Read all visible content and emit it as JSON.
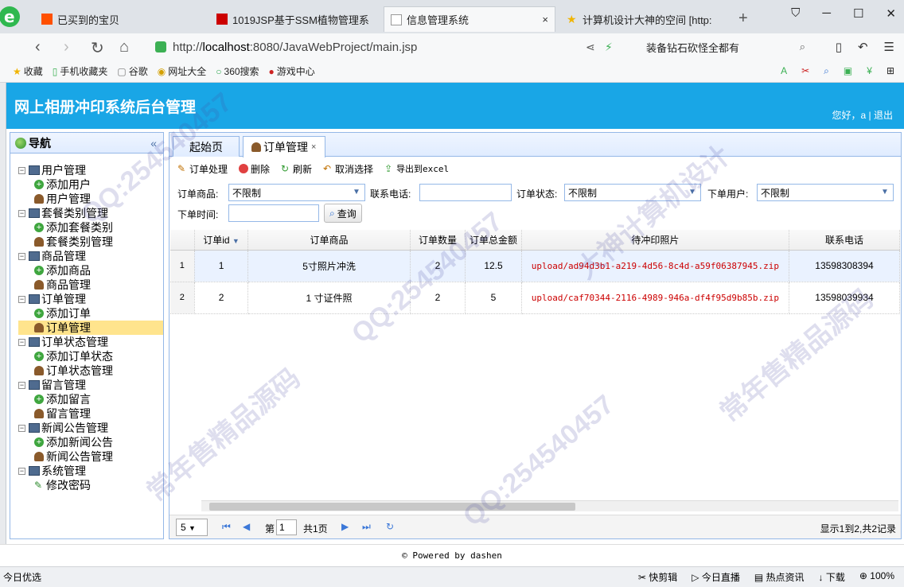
{
  "browser": {
    "tabs": [
      {
        "label": "已买到的宝贝"
      },
      {
        "label": "1019JSP基于SSM植物管理系"
      },
      {
        "label": "信息管理系统",
        "close": "×"
      },
      {
        "label": "计算机设计大神的空间 [http:"
      }
    ],
    "new_tab": "+",
    "url_prefix": "http://",
    "url_host": "localhost",
    "url_rest": ":8080/JavaWebProject/main.jsp",
    "search_text": "装备钻石砍怪全都有",
    "bookmarks": [
      "收藏",
      "手机收藏夹",
      "谷歌",
      "网址大全",
      "360搜索",
      "游戏中心"
    ]
  },
  "app": {
    "title": "网上相册冲印系统后台管理",
    "greeting": "您好，a",
    "logout": "退出"
  },
  "nav": {
    "title": "导航",
    "collapse": "«",
    "groups": [
      {
        "label": "用户管理",
        "children": [
          {
            "label": "添加用户",
            "icon": "add"
          },
          {
            "label": "用户管理",
            "icon": "person"
          }
        ]
      },
      {
        "label": "套餐类别管理",
        "children": [
          {
            "label": "添加套餐类别",
            "icon": "add"
          },
          {
            "label": "套餐类别管理",
            "icon": "person"
          }
        ]
      },
      {
        "label": "商品管理",
        "children": [
          {
            "label": "添加商品",
            "icon": "add"
          },
          {
            "label": "商品管理",
            "icon": "person"
          }
        ]
      },
      {
        "label": "订单管理",
        "children": [
          {
            "label": "添加订单",
            "icon": "add"
          },
          {
            "label": "订单管理",
            "icon": "person",
            "selected": true
          }
        ]
      },
      {
        "label": "订单状态管理",
        "children": [
          {
            "label": "添加订单状态",
            "icon": "add"
          },
          {
            "label": "订单状态管理",
            "icon": "person"
          }
        ]
      },
      {
        "label": "留言管理",
        "children": [
          {
            "label": "添加留言",
            "icon": "add"
          },
          {
            "label": "留言管理",
            "icon": "person"
          }
        ]
      },
      {
        "label": "新闻公告管理",
        "children": [
          {
            "label": "添加新闻公告",
            "icon": "add"
          },
          {
            "label": "新闻公告管理",
            "icon": "person"
          }
        ]
      },
      {
        "label": "系统管理",
        "children": [
          {
            "label": "修改密码",
            "icon": "pen"
          }
        ]
      }
    ]
  },
  "main": {
    "tabs": [
      {
        "label": "起始页"
      },
      {
        "label": "订单管理",
        "close": "×"
      }
    ],
    "toolbar": {
      "process": "订单处理",
      "delete": "删除",
      "refresh": "刷新",
      "cancel_select": "取消选择",
      "export": "导出到excel"
    },
    "filters": {
      "product_label": "订单商品:",
      "product_value": "不限制",
      "phone_label": "联系电话:",
      "phone_value": "",
      "status_label": "订单状态:",
      "status_value": "不限制",
      "user_label": "下单用户:",
      "user_value": "不限制",
      "time_label": "下单时间:",
      "time_value": "",
      "query": "查询"
    },
    "grid": {
      "columns": [
        "订单id",
        "订单商品",
        "订单数量",
        "订单总金额",
        "待冲印照片",
        "联系电话"
      ],
      "rows": [
        {
          "rn": "1",
          "id": "1",
          "product": "5寸照片冲洗",
          "qty": "2",
          "total": "12.5",
          "photo": "upload/ad94d3b1-a219-4d56-8c4d-a59f06387945.zip",
          "phone": "13598308394"
        },
        {
          "rn": "2",
          "id": "2",
          "product": "1 寸证件照",
          "qty": "2",
          "total": "5",
          "photo": "upload/caf70344-2116-4989-946a-df4f95d9b85b.zip",
          "phone": "13598039934"
        }
      ]
    },
    "pager": {
      "page_size": "5",
      "page_prefix": "第",
      "page_value": "1",
      "page_total": "共1页",
      "summary": "显示1到2,共2记录"
    }
  },
  "footer": "Powered by dashen",
  "statusbar": {
    "left": "今日优选",
    "items": [
      "快剪辑",
      "今日直播",
      "热点资讯",
      "下载",
      "100%"
    ]
  },
  "watermark": [
    "QQ:254540457",
    "大神计算机设计",
    "常年售精品源码"
  ]
}
